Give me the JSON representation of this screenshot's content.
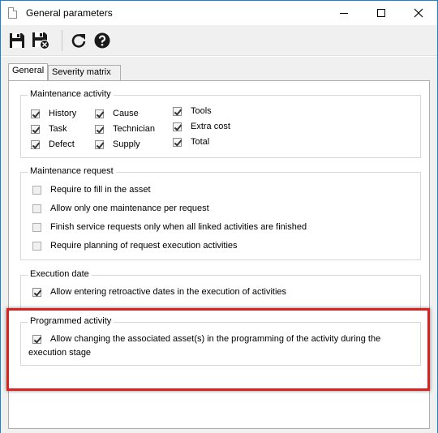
{
  "window": {
    "title": "General parameters"
  },
  "tabs": [
    {
      "label": "General"
    },
    {
      "label": "Severity matrix"
    }
  ],
  "maintenance_activity": {
    "title": "Maintenance activity",
    "items": [
      {
        "label": "History",
        "checked": true
      },
      {
        "label": "Task",
        "checked": true
      },
      {
        "label": "Defect",
        "checked": true
      },
      {
        "label": "Cause",
        "checked": true
      },
      {
        "label": "Technician",
        "checked": true
      },
      {
        "label": "Supply",
        "checked": true
      },
      {
        "label": "Tools",
        "checked": true
      },
      {
        "label": "Extra cost",
        "checked": true
      },
      {
        "label": "Total",
        "checked": true
      }
    ]
  },
  "maintenance_request": {
    "title": "Maintenance request",
    "items": [
      {
        "label": "Require to fill in the asset",
        "checked": false
      },
      {
        "label": "Allow only one maintenance per request",
        "checked": false
      },
      {
        "label": "Finish service requests only when all linked activities are finished",
        "checked": false
      },
      {
        "label": "Require planning of request execution activities",
        "checked": false
      }
    ]
  },
  "execution_date": {
    "title": "Execution date",
    "items": [
      {
        "label": "Allow entering retroactive dates in the execution of activities",
        "checked": true
      }
    ]
  },
  "programmed_activity": {
    "title": "Programmed activity",
    "items": [
      {
        "label_line1": "Allow changing the associated asset(s) in the programming of the activity during the",
        "label_line2": "execution stage",
        "checked": true
      }
    ]
  },
  "colors": {
    "highlight": "#d9231f",
    "window_border": "#1883d7"
  }
}
